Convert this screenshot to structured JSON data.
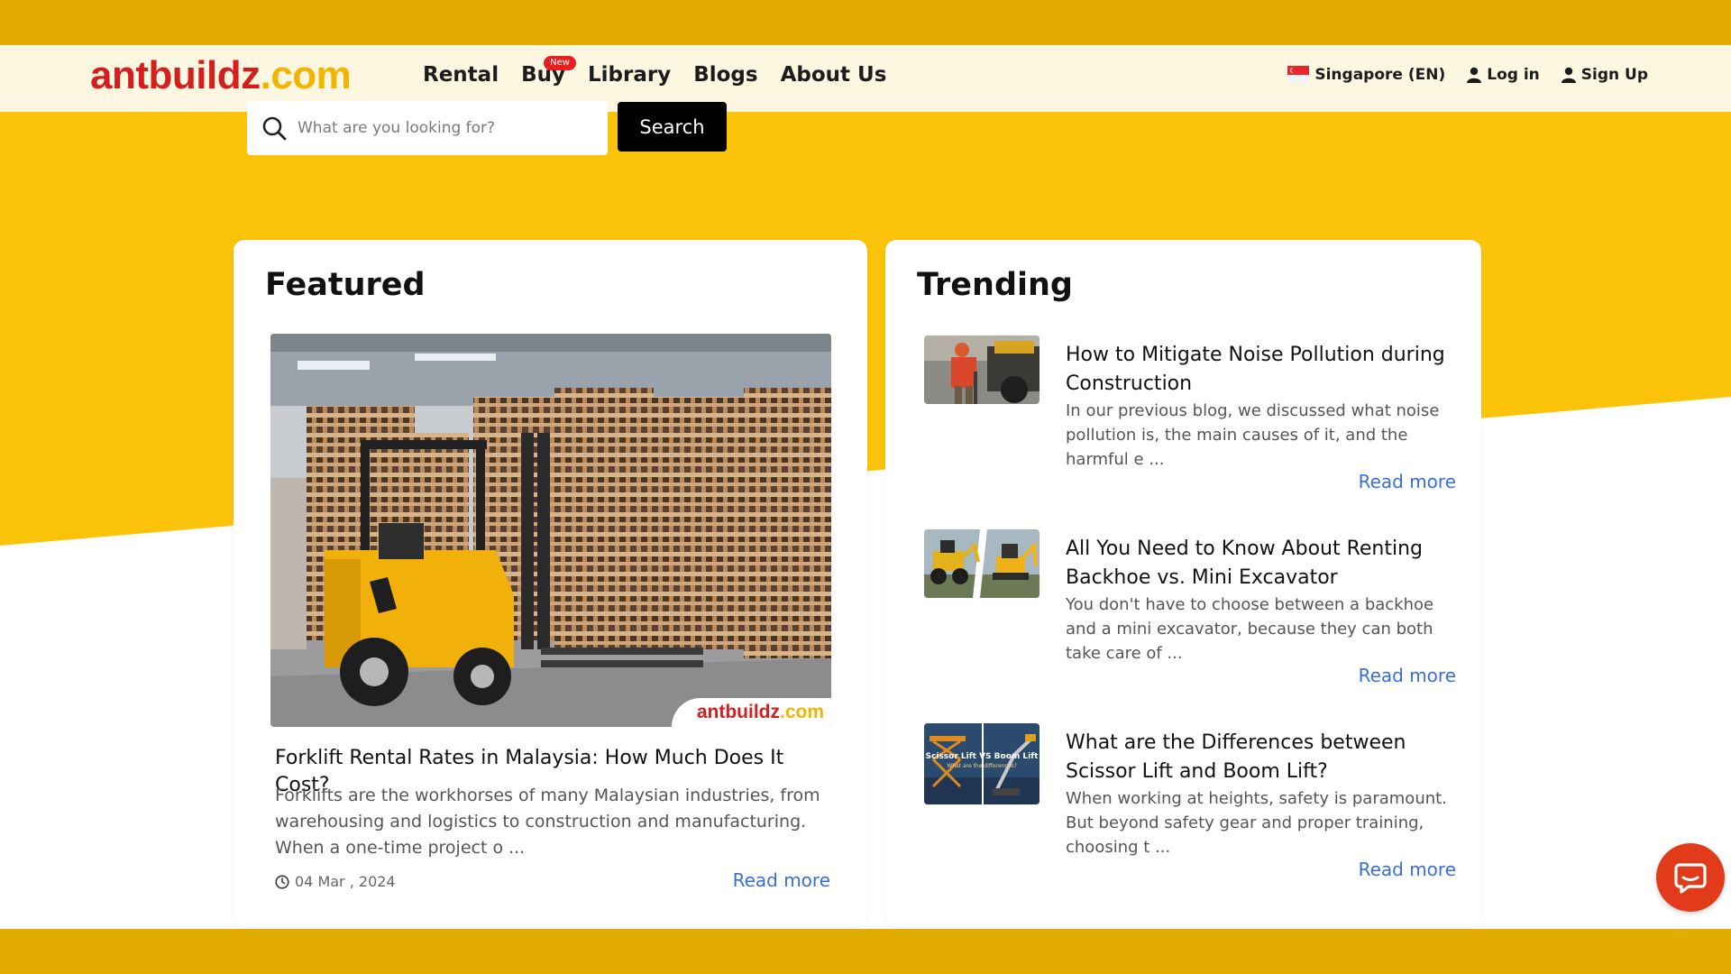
{
  "brand": {
    "logo_main": "antbuildz",
    "logo_tld": ".com"
  },
  "nav": {
    "items": [
      {
        "label": "Rental"
      },
      {
        "label": "Buy",
        "badge": "New"
      },
      {
        "label": "Library"
      },
      {
        "label": "Blogs"
      },
      {
        "label": "About Us"
      }
    ]
  },
  "header_right": {
    "region": "Singapore (EN)",
    "login": "Log in",
    "signup": "Sign Up"
  },
  "search": {
    "placeholder": "What are you looking for?",
    "button_label": "Search"
  },
  "featured": {
    "heading": "Featured",
    "image_brand_main": "antbuildz",
    "image_brand_tld": ".com",
    "title": "Forklift Rental Rates in Malaysia: How Much Does It Cost?",
    "excerpt": "Forklifts are the workhorses of many Malaysian industries, from warehousing and logistics to construction and manufacturing. When a one-time project o ...",
    "date": "04 Mar , 2024",
    "read_more": "Read more"
  },
  "trending": {
    "heading": "Trending",
    "items": [
      {
        "title": "How to Mitigate Noise Pollution during Construction",
        "excerpt": "In our previous blog, we discussed what noise pollution is, the main causes of it, and the harmful e ...",
        "read_more": "Read more",
        "thumb": "construction-worker-thumbnail"
      },
      {
        "title": "All You Need to Know About Renting Backhoe vs. Mini Excavator",
        "excerpt": "You don't have to choose between a backhoe and a mini excavator, because they can both take care of ...",
        "read_more": "Read more",
        "thumb": "backhoe-excavator-thumbnail"
      },
      {
        "title": "What are the Differences between Scissor Lift and Boom Lift?",
        "excerpt": "When working at heights, safety is paramount. But beyond safety gear and proper training, choosing t ...",
        "read_more": "Read more",
        "thumb": "scissor-boom-lift-thumbnail",
        "thumb_text": "Scissor Lift VS Boom Lift",
        "thumb_subtext": "What are the differences?"
      }
    ]
  },
  "colors": {
    "yellow": "#fcc30b",
    "band": "#e2ad00",
    "header_bg": "#fdf6e0",
    "brand_red": "#d41f1f",
    "link_blue": "#3a6fd8",
    "chat_red": "#e23b1c"
  },
  "icons": {
    "search": "search-icon",
    "user": "user-icon",
    "clock": "clock-icon",
    "chat": "chat-icon",
    "flag": "singapore-flag-icon"
  }
}
